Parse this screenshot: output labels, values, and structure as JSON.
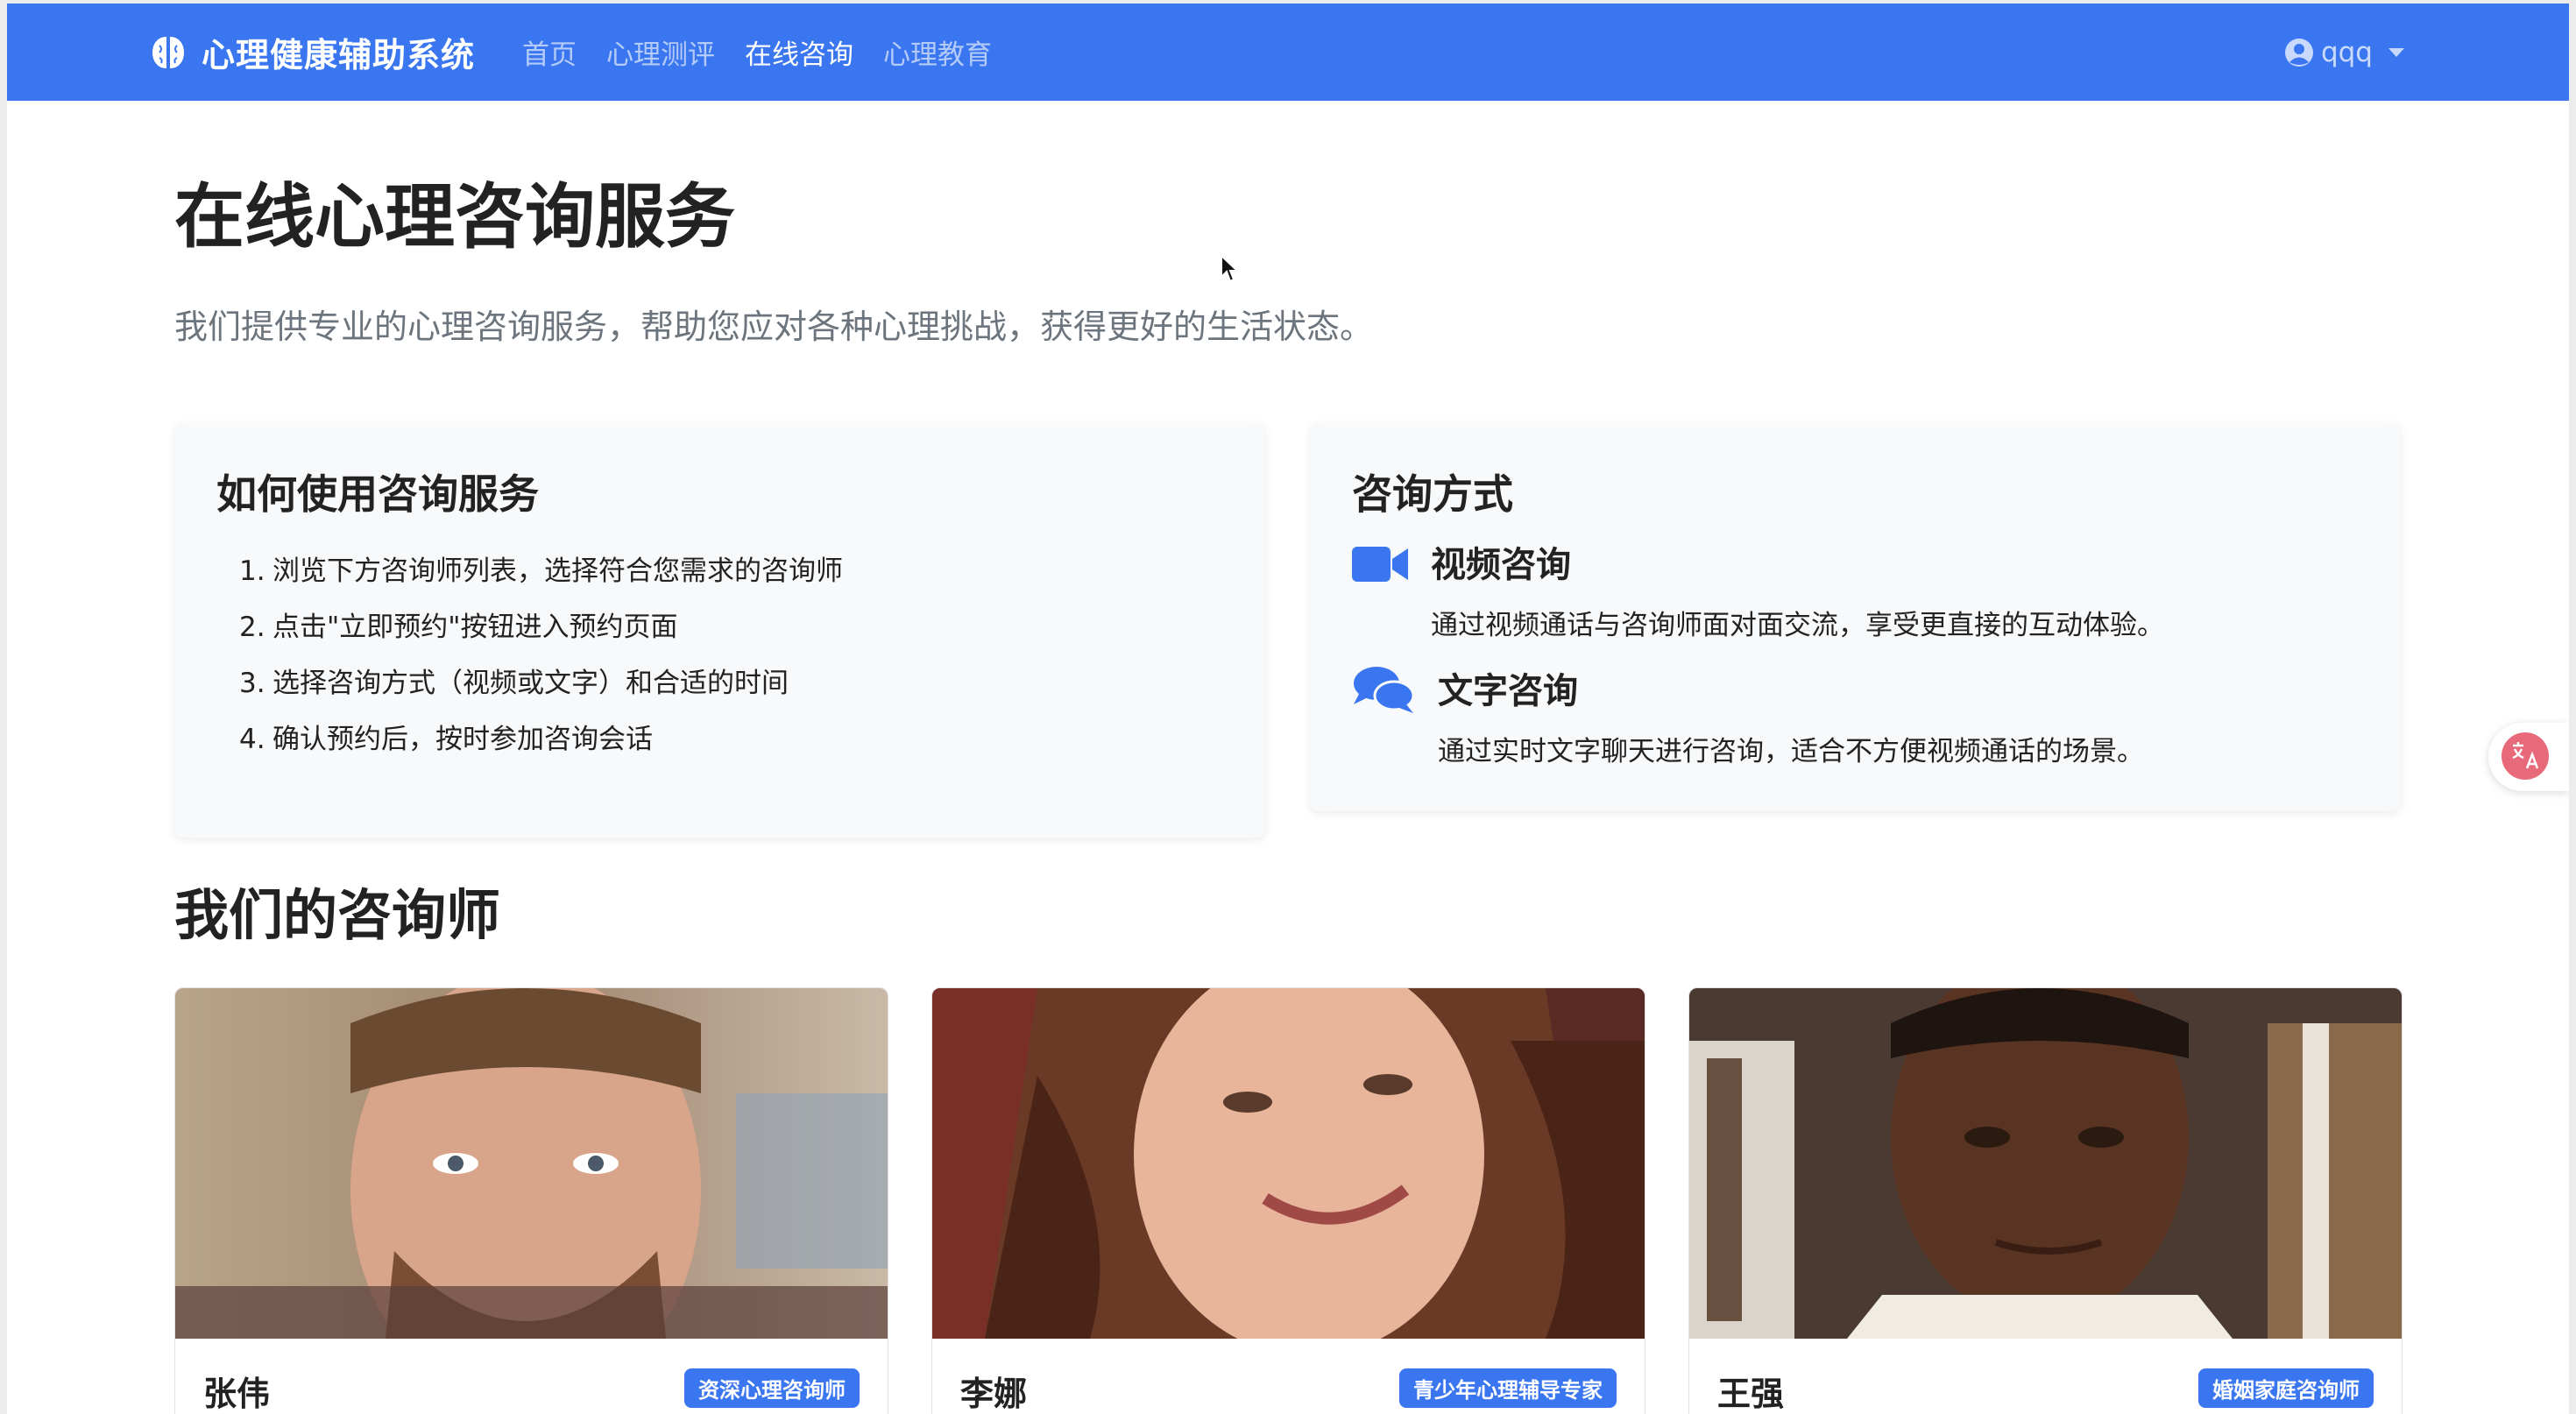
{
  "navbar": {
    "brand": "心理健康辅助系统",
    "brand_icon": "brain-icon",
    "links": [
      "首页",
      "心理测评",
      "在线咨询",
      "心理教育"
    ],
    "active_link": "在线咨询",
    "username": "qqq",
    "user_icon": "user-circle-icon"
  },
  "hero": {
    "title": "在线心理咨询服务",
    "lead": "我们提供专业的心理咨询服务，帮助您应对各种心理挑战，获得更好的生活状态。"
  },
  "how_to": {
    "title": "如何使用咨询服务",
    "steps": [
      {
        "num": "1.",
        "text": "浏览下方咨询师列表，选择符合您需求的咨询师"
      },
      {
        "num": "2.",
        "text": "点击\"立即预约\"按钮进入预约页面"
      },
      {
        "num": "3.",
        "text": "选择咨询方式（视频或文字）和合适的时间"
      },
      {
        "num": "4.",
        "text": "确认预约后，按时参加咨询会话"
      }
    ]
  },
  "methods": {
    "title": "咨询方式",
    "items": [
      {
        "icon": "video-camera-icon",
        "title": "视频咨询",
        "desc": "通过视频通话与咨询师面对面交流，享受更直接的互动体验。"
      },
      {
        "icon": "chat-bubbles-icon",
        "title": "文字咨询",
        "desc": "通过实时文字聊天进行咨询，适合不方便视频通话的场景。"
      }
    ]
  },
  "counselors": {
    "title": "我们的咨询师",
    "items": [
      {
        "name": "张伟",
        "badge": "资深心理咨询师"
      },
      {
        "name": "李娜",
        "badge": "青少年心理辅导专家"
      },
      {
        "name": "王强",
        "badge": "婚姻家庭咨询师"
      }
    ]
  },
  "colors": {
    "primary": "#3a76f0",
    "panel_bg": "#f8f9fa"
  }
}
